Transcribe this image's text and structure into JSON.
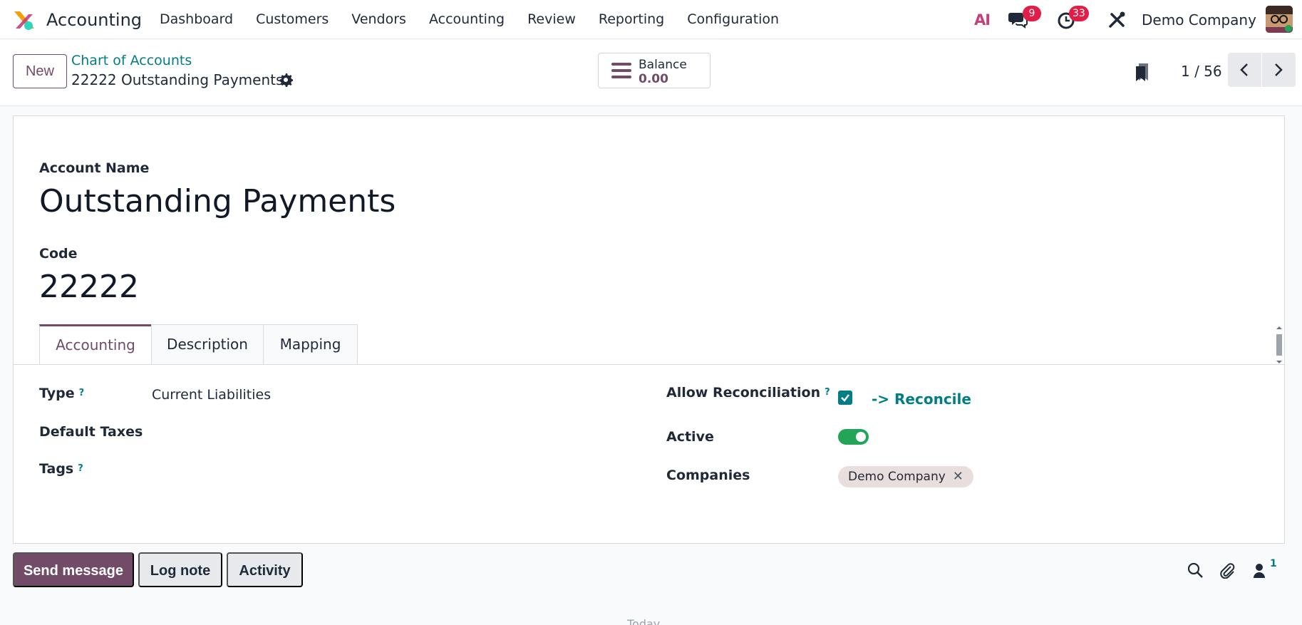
{
  "navbar": {
    "app_name": "Accounting",
    "menu": [
      "Dashboard",
      "Customers",
      "Vendors",
      "Accounting",
      "Review",
      "Reporting",
      "Configuration"
    ],
    "ai_label": "AI",
    "messages_badge": "9",
    "activities_badge": "33",
    "company": "Demo Company"
  },
  "control_panel": {
    "new_label": "New",
    "breadcrumb_parent": "Chart of Accounts",
    "breadcrumb_current": "22222 Outstanding Payments",
    "balance_label": "Balance",
    "balance_value": "0.00",
    "pager": "1 / 56"
  },
  "form": {
    "account_name_label": "Account Name",
    "account_name": "Outstanding Payments",
    "code_label": "Code",
    "code": "22222",
    "tabs": [
      "Accounting",
      "Description",
      "Mapping"
    ],
    "help_mark": "?",
    "left_fields": {
      "type_label": "Type",
      "type_value": "Current Liabilities",
      "default_taxes_label": "Default Taxes",
      "tags_label": "Tags"
    },
    "right_fields": {
      "allow_reconciliation_label": "Allow Reconciliation",
      "reconcile_link": "-> Reconcile",
      "active_label": "Active",
      "companies_label": "Companies",
      "company_tag": "Demo Company"
    }
  },
  "chatter": {
    "send_message": "Send message",
    "log_note": "Log note",
    "activity": "Activity",
    "followers_count": "1",
    "today": "Today"
  },
  "colors": {
    "brand": "#714b67",
    "link": "#017e84",
    "badge": "#e11d48",
    "toggle_on": "#22a559"
  }
}
